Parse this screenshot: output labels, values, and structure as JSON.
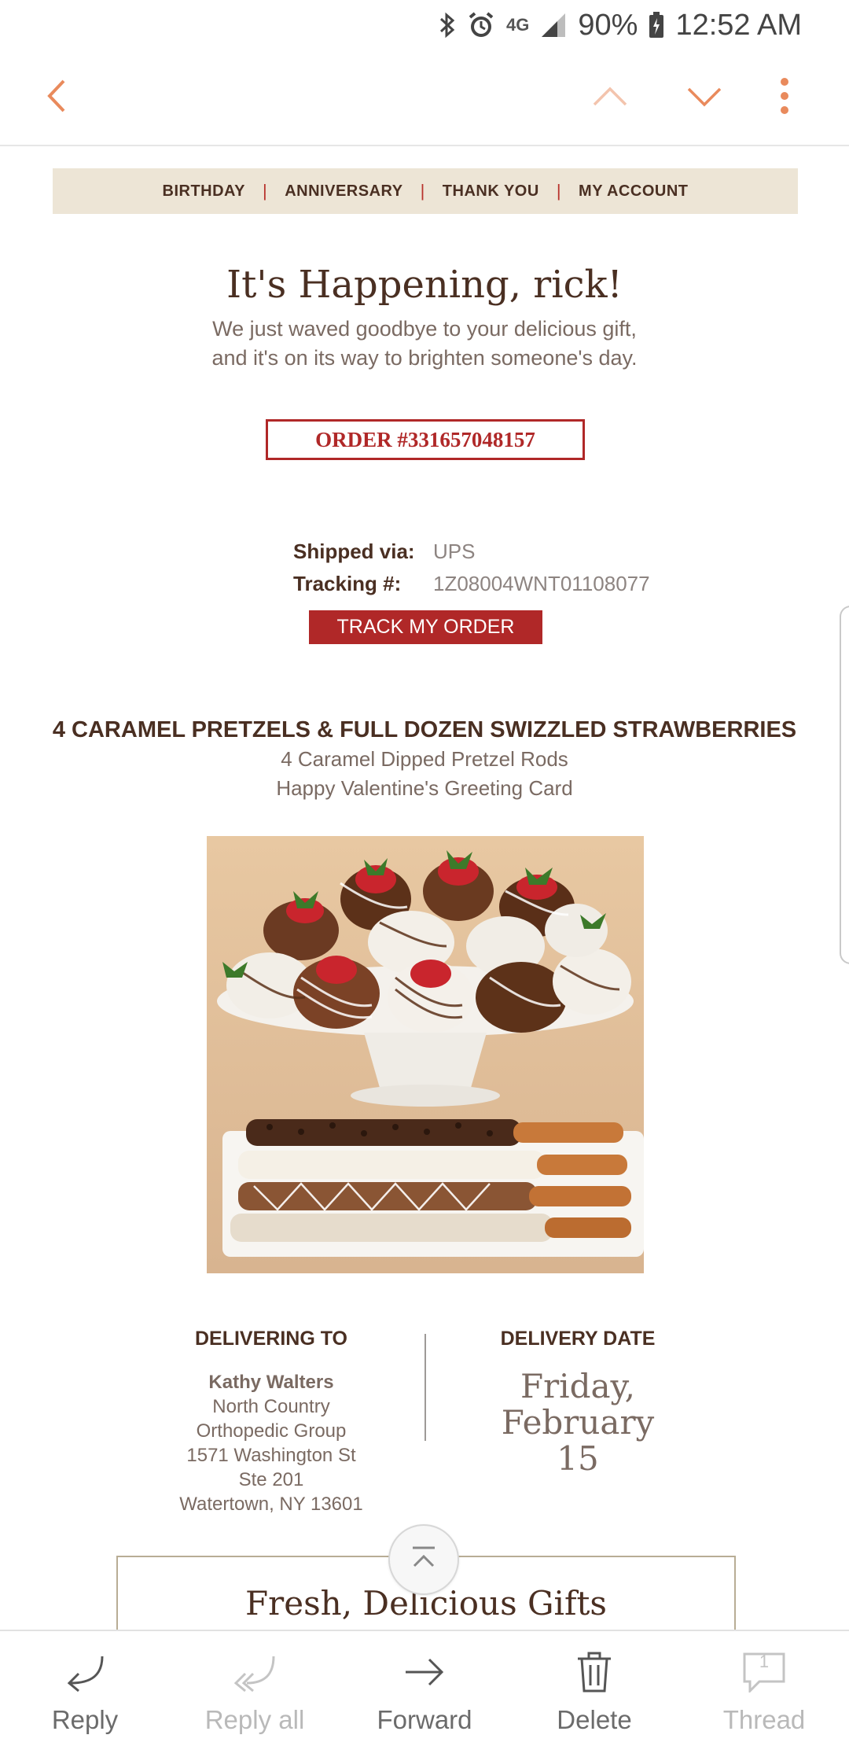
{
  "status_bar": {
    "network": "4G",
    "battery": "90%",
    "time": "12:52 AM"
  },
  "app_bar": {
    "back_icon": "chevron-left-icon",
    "prev_icon": "chevron-up-icon",
    "next_icon": "chevron-down-icon",
    "more_icon": "more-vert-icon",
    "accent_color": "#e98a5c"
  },
  "email": {
    "nav": [
      "BIRTHDAY",
      "ANNIVERSARY",
      "THANK YOU",
      "MY ACCOUNT"
    ],
    "headline": "It's Happening, rick!",
    "subtext_line1": "We just waved goodbye to your delicious gift,",
    "subtext_line2": "and it's on its way to brighten someone's day.",
    "order_label": "ORDER #331657048157",
    "shipped_via_label": "Shipped via:",
    "shipped_via_value": "UPS",
    "tracking_label": "Tracking #:",
    "tracking_value": "1Z08004WNT01108077",
    "track_button": "TRACK MY ORDER",
    "product_title": "4 CARAMEL PRETZELS & FULL DOZEN SWIZZLED STRAWBERRIES",
    "product_item1": "4 Caramel Dipped Pretzel Rods",
    "product_item2": "Happy Valentine's Greeting Card",
    "delivering_to_label": "DELIVERING TO",
    "recipient_name": "Kathy Walters",
    "address_line1": "North Country",
    "address_line2": "Orthopedic Group",
    "address_line3": "1571 Washington St",
    "address_line4": "Ste 201",
    "address_line5": "Watertown, NY 13601",
    "delivery_date_label": "DELIVERY DATE",
    "delivery_day": "Friday,",
    "delivery_month": "February",
    "delivery_daynum": "15",
    "promo_title": "Fresh, Delicious Gifts",
    "brand_red": "#b02828",
    "nav_bg": "#ede5d6"
  },
  "bottom_bar": {
    "items": [
      {
        "label": "Reply",
        "icon": "reply-icon",
        "enabled": true
      },
      {
        "label": "Reply all",
        "icon": "reply-all-icon",
        "enabled": false
      },
      {
        "label": "Forward",
        "icon": "forward-icon",
        "enabled": true
      },
      {
        "label": "Delete",
        "icon": "trash-icon",
        "enabled": true
      },
      {
        "label": "Thread",
        "icon": "thread-icon",
        "badge": "1",
        "enabled": false
      }
    ]
  }
}
